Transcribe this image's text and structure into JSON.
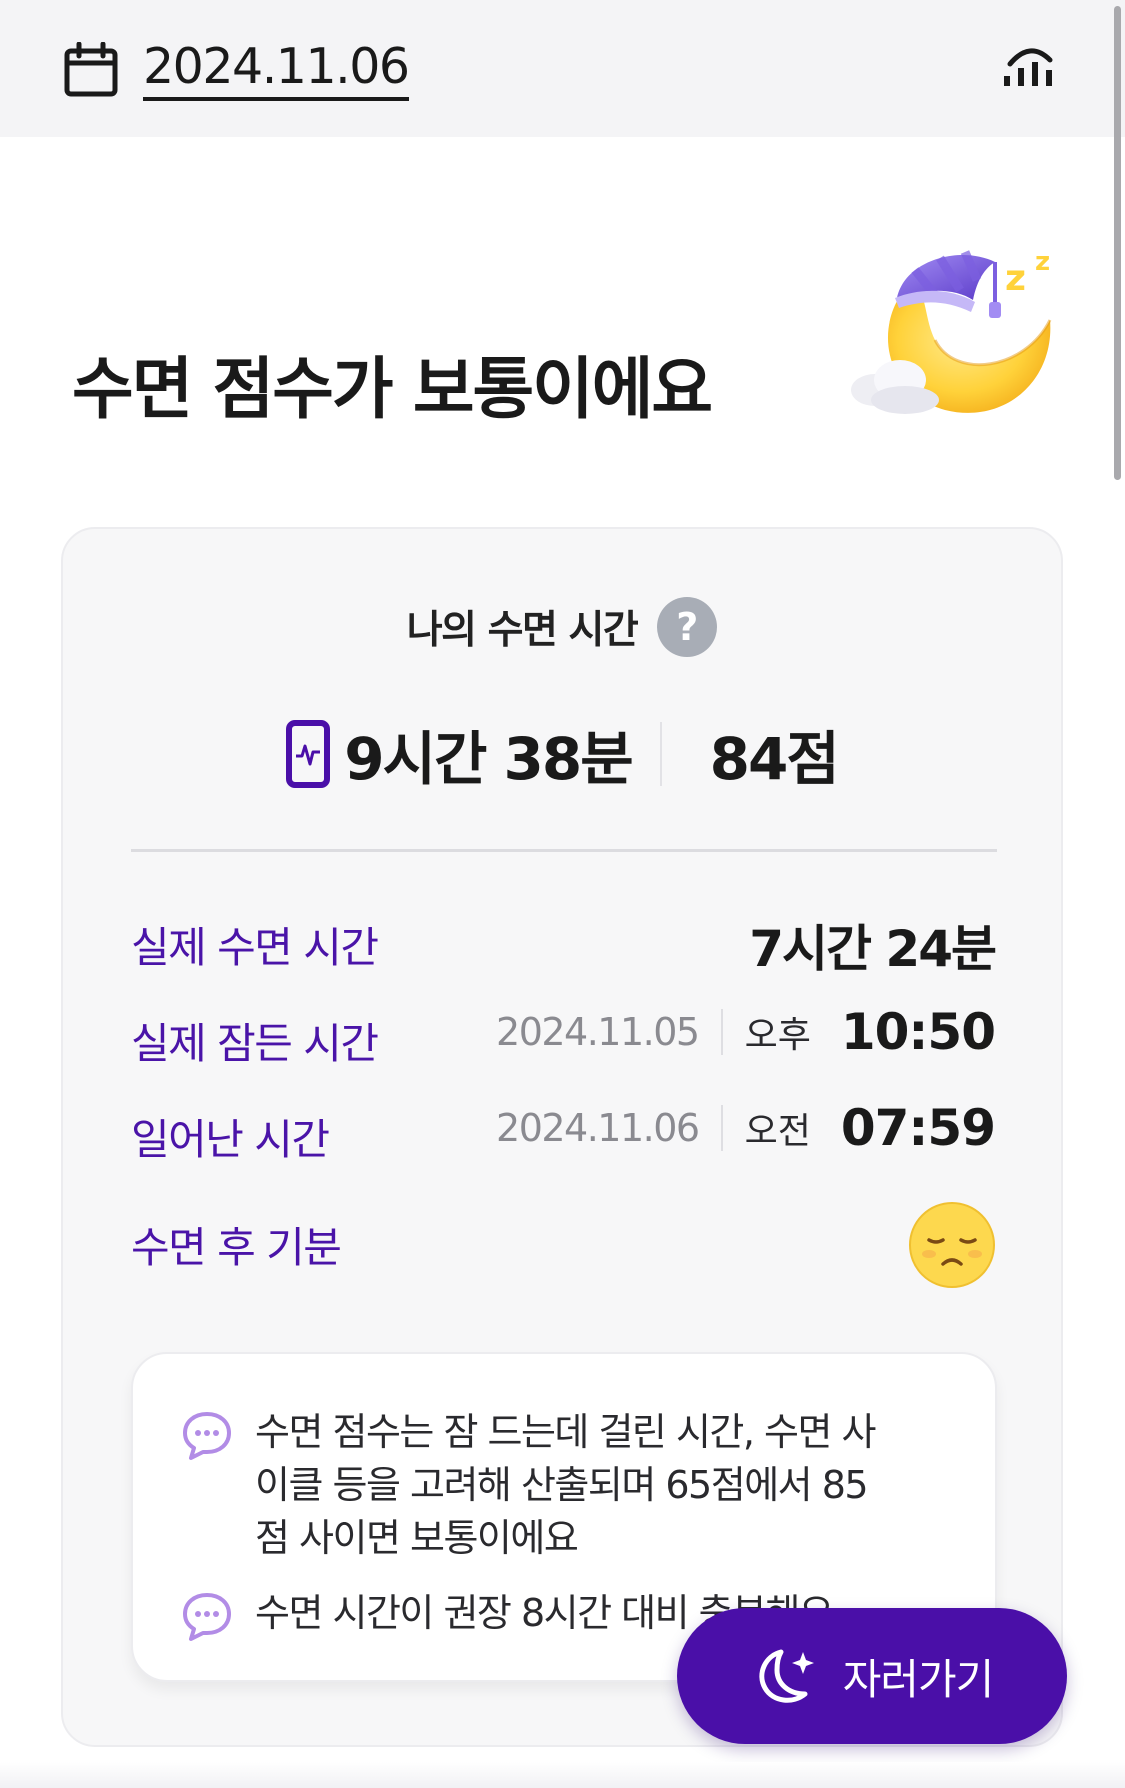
{
  "header": {
    "date": "2024.11.06",
    "calendar_icon": "calendar-icon",
    "stats_icon": "bar-chart-icon"
  },
  "title": "수면 점수가 보통이에요",
  "illustration": "sleeping-moon-icon",
  "card": {
    "heading": "나의 수면 시간",
    "help_glyph": "?",
    "summary": {
      "device_icon": "phone-heartbeat-icon",
      "duration": "9시간 38분",
      "score": "84점"
    },
    "details": {
      "actual_sleep": {
        "label": "실제 수면 시간",
        "value": "7시간 24분"
      },
      "fell_asleep": {
        "label": "실제 잠든 시간",
        "date": "2024.11.05",
        "ampm": "오후",
        "time": "10:50"
      },
      "woke_up": {
        "label": "일어난 시간",
        "date": "2024.11.06",
        "ampm": "오전",
        "time": "07:59"
      },
      "mood": {
        "label": "수면 후 기분",
        "icon": "sad-face-icon"
      }
    },
    "info": [
      {
        "icon": "chat-bubble-icon",
        "text": "수면 점수는 잠 드는데 걸린 시간, 수면 사이클 등을 고려해 산출되며 65점에서 85점 사이면 보통이에요"
      },
      {
        "icon": "chat-bubble-icon",
        "text": "수면 시간이 권장 8시간 대비 충분해요"
      }
    ]
  },
  "sleep_button": {
    "label": "자러가기",
    "icon": "moon-sparkle-icon"
  },
  "colors": {
    "accent": "#4A0FA8",
    "label_purple": "#4A14A8",
    "header_bg": "#F4F4F6",
    "card_bg": "#F7F7F8",
    "mood_yellow": "#FDD84E"
  }
}
